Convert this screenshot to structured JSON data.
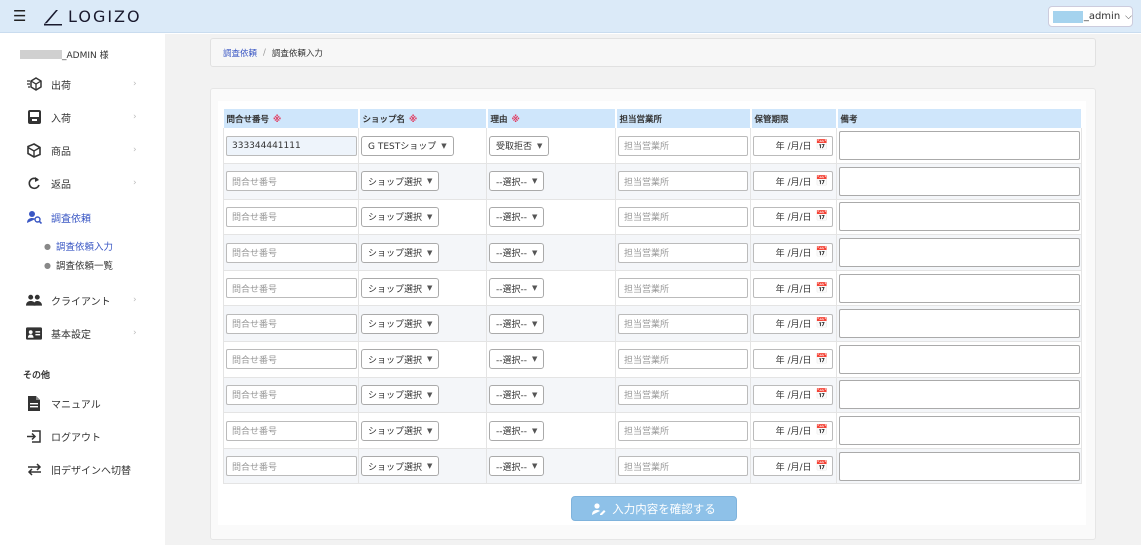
{
  "header": {
    "logo_text": "LOGIZO",
    "user_suffix": "_admin"
  },
  "sidebar": {
    "admin_suffix": "_ADMIN 様",
    "items": [
      {
        "label": "出荷",
        "icon": "shipping-box-icon"
      },
      {
        "label": "入荷",
        "icon": "inbox-icon"
      },
      {
        "label": "商品",
        "icon": "cube-icon"
      },
      {
        "label": "返品",
        "icon": "return-arrow-icon"
      },
      {
        "label": "調査依頼",
        "icon": "user-search-icon"
      },
      {
        "label": "クライアント",
        "icon": "people-icon"
      },
      {
        "label": "基本設定",
        "icon": "id-card-icon"
      }
    ],
    "sub_items": [
      "調査依頼入力",
      "調査依頼一覧"
    ],
    "other_label": "その他",
    "other_items": [
      {
        "label": "マニュアル",
        "icon": "document-icon"
      },
      {
        "label": "ログアウト",
        "icon": "logout-icon"
      },
      {
        "label": "旧デザインへ切替",
        "icon": "swap-icon"
      }
    ]
  },
  "breadcrumb": {
    "parent": "調査依頼",
    "separator": "/",
    "current": "調査依頼入力"
  },
  "table": {
    "required_mark": "※",
    "headers": [
      "問合せ番号",
      "ショップ名",
      "理由",
      "担当営業所",
      "保管期限",
      "備考"
    ],
    "inquiry_placeholder": "問合せ番号",
    "shop_placeholder": "ショップ選択",
    "reason_placeholder": "--選択--",
    "office_placeholder": "担当営業所",
    "date_placeholder": "年 /月/日",
    "first_row": {
      "inquiry": "333344441111",
      "shop": "G TESTショップ",
      "reason": "受取拒否"
    }
  },
  "confirm_button": "入力内容を確認する",
  "colors": {
    "accent": "#3a57c4",
    "header_bg": "#dbeaf8",
    "table_header": "#cfe6fb",
    "required": "#e0395e",
    "button": "#8ec1e8"
  }
}
